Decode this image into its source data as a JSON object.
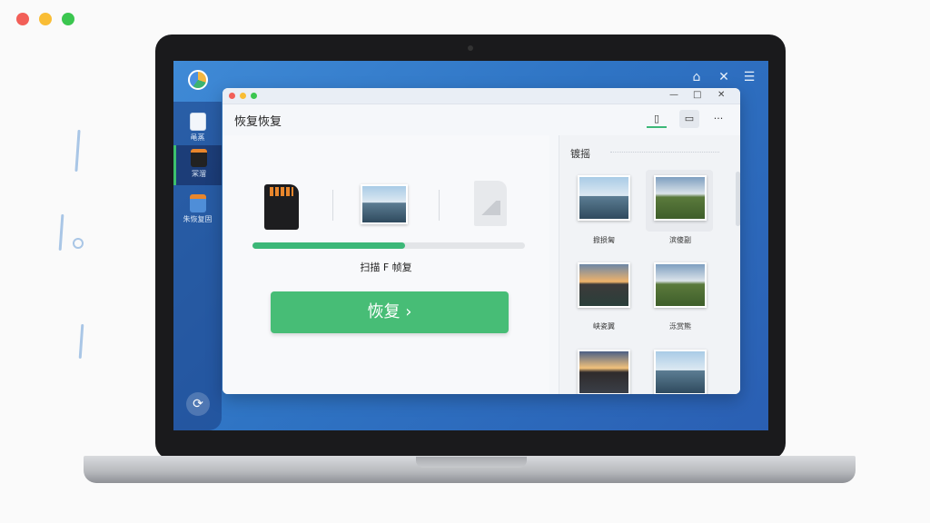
{
  "window": {
    "traffic_lights": [
      "#f25f58",
      "#f9bd35",
      "#3bc64f"
    ]
  },
  "app": {
    "top_icons": [
      "feedback-icon",
      "close-icon",
      "menu-icon"
    ],
    "sidebar": {
      "items": [
        {
          "label": "黾蒸",
          "icon": "file-icon"
        },
        {
          "label": "冞溜",
          "icon": "sd-card-icon",
          "active": true
        },
        {
          "label": "朱恢复固",
          "icon": "folder-icon"
        }
      ],
      "bottom_icon": "sync-icon"
    },
    "dialog": {
      "controls": [
        "—",
        "□",
        "✕"
      ],
      "title": "恢复恢复",
      "header_icons": [
        "document-icon",
        "image-icon",
        "more-icon"
      ],
      "more_label": "···",
      "progress": 0.56,
      "status": "扫描 F 帧复",
      "recover_button": "恢复 ›",
      "right_panel": {
        "title": "镀摇",
        "captions": [
          "掀损匐",
          "滨傻副",
          "峡瓷翼",
          "泺赏熊"
        ]
      }
    }
  }
}
